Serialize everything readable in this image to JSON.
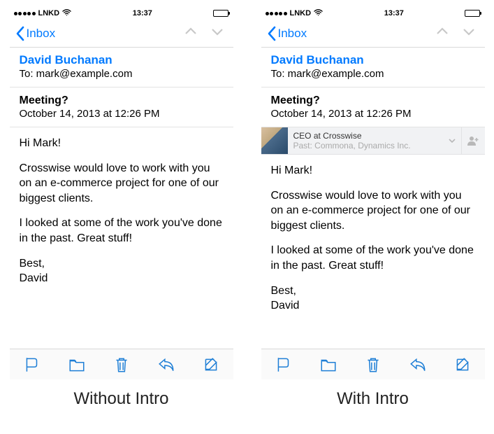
{
  "status": {
    "carrier": "LNKD",
    "time": "13:37"
  },
  "nav": {
    "back_label": "Inbox"
  },
  "header": {
    "sender": "David Buchanan",
    "to_line": "To: mark@example.com"
  },
  "subject_block": {
    "subject": "Meeting?",
    "date": "October 14, 2013 at 12:26 PM"
  },
  "intro_card": {
    "title_line": "CEO at Crosswise",
    "past_line": "Past: Commona, Dynamics Inc."
  },
  "body": {
    "p1": "Hi Mark!",
    "p2": "Crosswise would love to work with you on an e-commerce project for one of our biggest clients.",
    "p3": "I looked at some of the work you've done in the past. Great stuff!",
    "p4": "Best,",
    "p5": "David"
  },
  "captions": {
    "left": "Without Intro",
    "right": "With Intro"
  }
}
